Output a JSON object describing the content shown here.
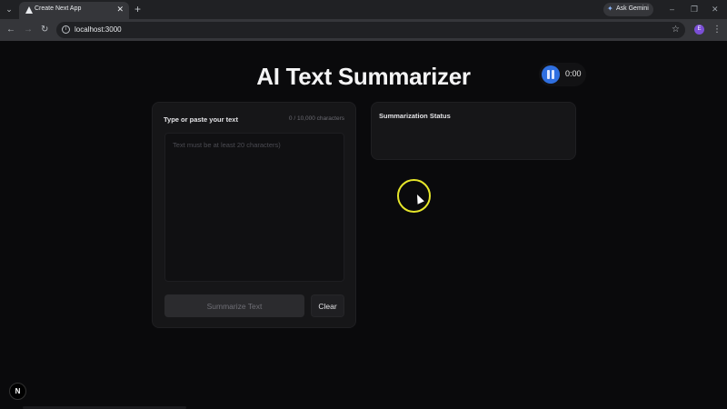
{
  "browser": {
    "tab_title": "Create Next App",
    "tab_close": "✕",
    "new_tab": "+",
    "ask_gemini_label": "Ask Gemini",
    "url": "localhost:3000",
    "profile_initial": "E"
  },
  "page": {
    "title": "AI Text Summarizer",
    "recorder_time": "0:00",
    "input_card": {
      "label": "Type or paste your text",
      "char_count": "0 / 10,000 characters",
      "placeholder": "Text must be at least 20 characters)",
      "value": "",
      "summarize_label": "Summarize Text",
      "clear_label": "Clear"
    },
    "status_card": {
      "title": "Summarization Status"
    },
    "next_badge": "N"
  },
  "colors": {
    "background": "#0a0a0c",
    "card": "#161618",
    "recorder_accent": "#2f6fe0",
    "cursor_ring": "#e6e62a"
  },
  "icons": [
    "tab-list-chevron-icon",
    "next-favicon-icon",
    "gemini-sparkle-icon",
    "back-arrow-icon",
    "forward-arrow-icon",
    "reload-icon",
    "site-info-icon",
    "bookmark-star-icon",
    "kebab-menu-icon",
    "pause-icon"
  ]
}
